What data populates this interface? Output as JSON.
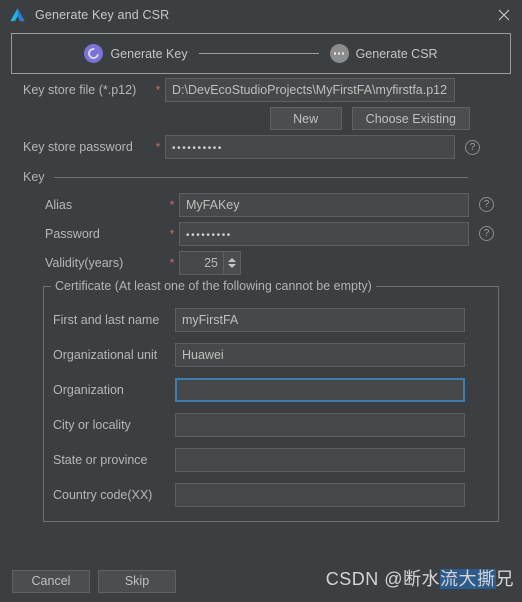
{
  "window": {
    "title": "Generate Key and CSR",
    "logo_icon": "deveco-studio-logo-icon",
    "close_icon": "close-icon"
  },
  "stepper": {
    "steps": [
      {
        "label": "Generate Key",
        "state": "active",
        "icon": "spinner-circle-icon"
      },
      {
        "label": "Generate CSR",
        "state": "pending",
        "icon": "ellipsis-circle-icon"
      }
    ]
  },
  "keystore": {
    "file_label": "Key store file (*.p12)",
    "file_required": "*",
    "file_value": "D:\\DevEcoStudioProjects\\MyFirstFA\\myfirstfa.p12",
    "new_button": "New",
    "choose_existing_button": "Choose Existing",
    "password_label": "Key store password",
    "password_required": "*",
    "password_value": "••••••••••",
    "help_icon": "question-mark-icon"
  },
  "key": {
    "group_title": "Key",
    "alias_label": "Alias",
    "alias_required": "*",
    "alias_value": "MyFAKey",
    "password_label": "Password",
    "password_required": "*",
    "password_value": "•••••••••",
    "validity_label": "Validity(years)",
    "validity_required": "*",
    "validity_value": "25",
    "spinner_up_icon": "chevron-up-icon",
    "spinner_down_icon": "chevron-down-icon"
  },
  "certificate": {
    "legend": "Certificate (At least one of the following cannot be empty)",
    "fields": [
      {
        "label": "First and last name",
        "value": "myFirstFA",
        "focused": false
      },
      {
        "label": "Organizational unit",
        "value": "Huawei",
        "focused": false
      },
      {
        "label": "Organization",
        "value": "",
        "focused": true
      },
      {
        "label": "City or locality",
        "value": "",
        "focused": false
      },
      {
        "label": "State or province",
        "value": "",
        "focused": false
      },
      {
        "label": "Country code(XX)",
        "value": "",
        "focused": false
      }
    ]
  },
  "footer": {
    "cancel_button": "Cancel",
    "skip_button": "Skip"
  },
  "watermark": {
    "prefix": "CSDN @断水",
    "highlighted": "流大撕",
    "suffix": "兄"
  },
  "colors": {
    "window_background": "#3c3f41",
    "field_background": "#45494a",
    "field_border": "#5e6060",
    "focus_border": "#3e7cb1",
    "required_asterisk": "#cf6a6a",
    "step_active": "#7a72d4",
    "step_pending": "#8c8c8c",
    "text": "#bbbbbb",
    "selection_highlight": "#2d5b8e"
  }
}
